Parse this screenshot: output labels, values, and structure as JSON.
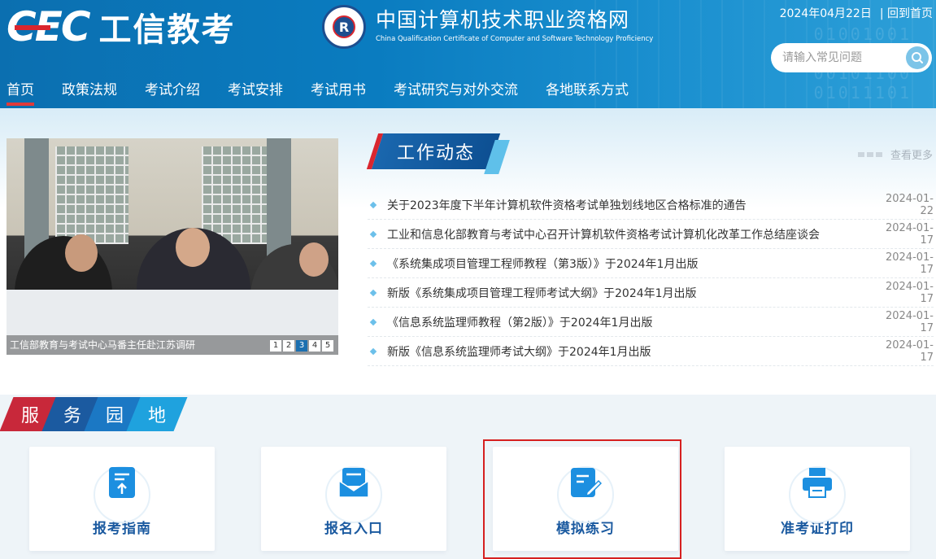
{
  "header": {
    "logo_cec": "CEC",
    "logo_text": "工信教考",
    "seal_letter": "R",
    "site_title_cn": "中国计算机技术职业资格网",
    "site_title_en": "China Qualification Certificate of Computer and Software Technology Proficiency",
    "date": "2024年04月22日",
    "home_link": "| 回到首页",
    "search_placeholder": "请输入常见问题",
    "nav": [
      "首页",
      "政策法规",
      "考试介绍",
      "考试安排",
      "考试用书",
      "考试研究与对外交流",
      "各地联系方式"
    ],
    "active_nav_index": 0
  },
  "slider": {
    "caption": "工信部教育与考试中心马番主任赴江苏调研",
    "pages": [
      "1",
      "2",
      "3",
      "4",
      "5"
    ],
    "current_page": "3"
  },
  "news": {
    "heading": "工作动态",
    "more_label": "查看更多",
    "items": [
      {
        "title": "关于2023年度下半年计算机软件资格考试单独划线地区合格标准的通告",
        "date": "2024-01-22"
      },
      {
        "title": "工业和信息化部教育与考试中心召开计算机软件资格考试计算机化改革工作总结座谈会",
        "date": "2024-01-17"
      },
      {
        "title": "《系统集成项目管理工程师教程（第3版）》于2024年1月出版",
        "date": "2024-01-17"
      },
      {
        "title": "新版《系统集成项目管理工程师考试大纲》于2024年1月出版",
        "date": "2024-01-17"
      },
      {
        "title": "《信息系统监理师教程（第2版）》于2024年1月出版",
        "date": "2024-01-17"
      },
      {
        "title": "新版《信息系统监理师考试大纲》于2024年1月出版",
        "date": "2024-01-17"
      }
    ]
  },
  "services": {
    "heading_chars": [
      "服",
      "务",
      "园",
      "地"
    ],
    "heading_colors": [
      "#c8283a",
      "#1b5aa0",
      "#1b78c4",
      "#1fa2de"
    ],
    "cards": [
      {
        "label": "报考指南",
        "icon": "guide-upload-icon"
      },
      {
        "label": "报名入口",
        "icon": "envelope-icon"
      },
      {
        "label": "模拟练习",
        "icon": "edit-document-icon"
      },
      {
        "label": "准考证打印",
        "icon": "printer-icon"
      }
    ],
    "highlighted_index": 2
  },
  "colors": {
    "brand_blue": "#0b6fb0",
    "accent_red": "#d62020",
    "icon_blue": "#1c8fe0",
    "card_text": "#1b5aa0"
  }
}
